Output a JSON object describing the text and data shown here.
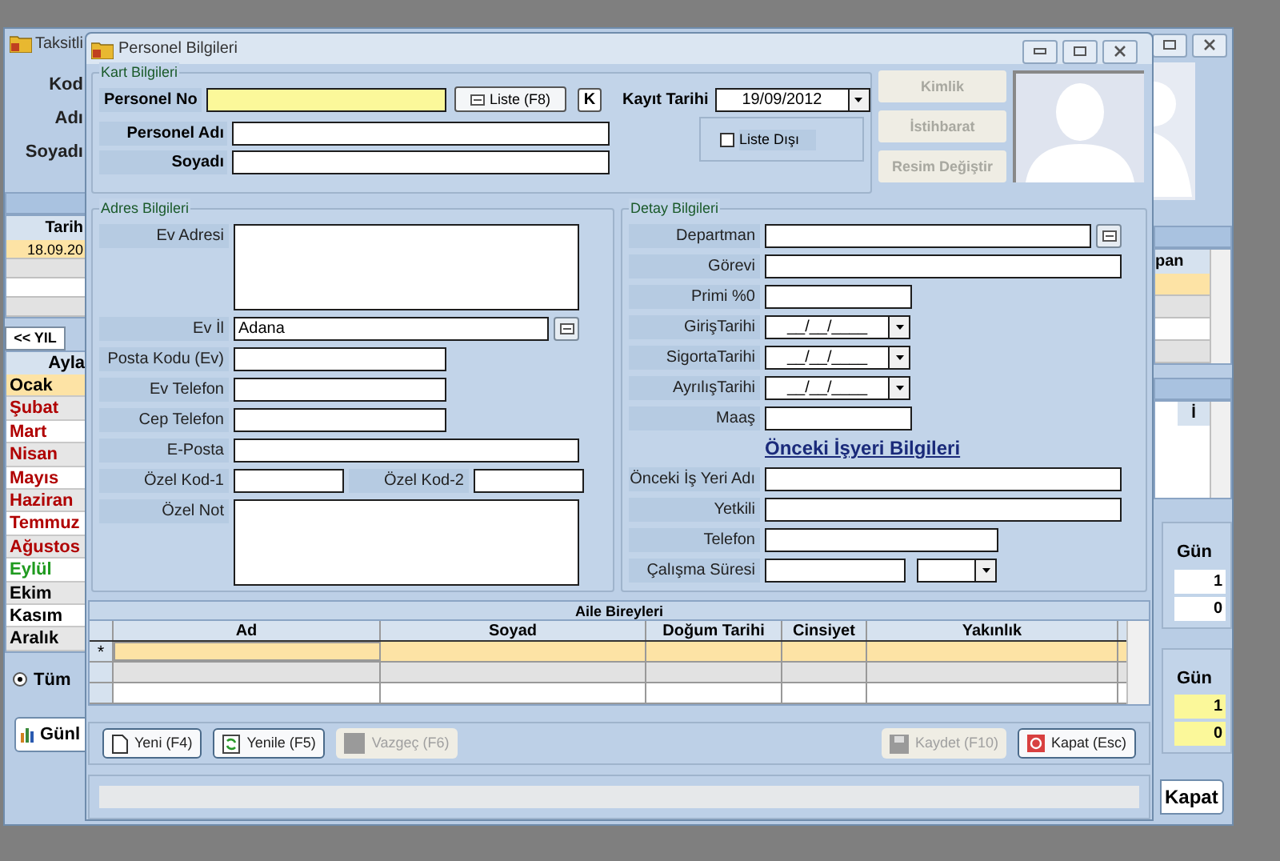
{
  "back_window": {
    "title": "Taksitli",
    "labels": [
      "Kod",
      "Adı",
      "Soyadı"
    ],
    "left_table": {
      "column": "Tarih",
      "rows": [
        {
          "value": "18.09.20",
          "selected": true
        },
        {
          "selected": false
        },
        {
          "selected": false
        },
        {
          "selected": false
        }
      ]
    },
    "year_button": "<< YIL",
    "months_column": "Ayla",
    "months": [
      {
        "name": "Ocak",
        "color": "#000000",
        "selected": true
      },
      {
        "name": "Şubat",
        "color": "#b00000",
        "selected": false
      },
      {
        "name": "Mart",
        "color": "#b00000",
        "selected": false
      },
      {
        "name": "Nisan",
        "color": "#b00000",
        "selected": false
      },
      {
        "name": "Mayıs",
        "color": "#b00000",
        "selected": false
      },
      {
        "name": "Haziran",
        "color": "#b00000",
        "selected": false
      },
      {
        "name": "Temmuz",
        "color": "#b00000",
        "selected": false
      },
      {
        "name": "Ağustos",
        "color": "#b00000",
        "selected": false
      },
      {
        "name": "Eylül",
        "color": "#1f9a1f",
        "selected": false
      },
      {
        "name": "Ekim",
        "color": "#000000",
        "selected": false
      },
      {
        "name": "Kasım",
        "color": "#000000",
        "selected": false
      },
      {
        "name": "Aralık",
        "color": "#000000",
        "selected": false
      }
    ],
    "radio": {
      "label": "Tüm",
      "selected": true
    },
    "report_button": "Günl",
    "right_table_1": {
      "column": "pan",
      "rows": [
        {
          "selected": true
        },
        {
          "selected": false
        },
        {
          "selected": false
        },
        {
          "selected": false
        }
      ]
    },
    "right_table_2": {
      "column": "İ"
    },
    "day_panels": [
      {
        "column": "Gün",
        "values": [
          "1",
          "0"
        ],
        "highlight": false
      },
      {
        "column": "Gün",
        "values": [
          "1",
          "0"
        ],
        "highlight": true
      }
    ],
    "close_button": "Kapat"
  },
  "window": {
    "title": "Personel Bilgileri"
  },
  "kart": {
    "title": "Kart Bilgileri",
    "personel_no": "Personel No",
    "list_button": "Liste (F8)",
    "k_button": "K",
    "date_label": "Kayıt Tarihi",
    "date_value": "19/09/2012",
    "name_label": "Personel Adı",
    "surname_label": "Soyadı",
    "off_list": {
      "label": "Liste Dışı",
      "checked": false
    },
    "side_buttons": [
      {
        "label": "Kimlik",
        "disabled": true
      },
      {
        "label": "İstihbarat",
        "disabled": true
      },
      {
        "label": "Resim Değiştir",
        "disabled": true
      }
    ]
  },
  "adres": {
    "title": "Adres Bilgileri",
    "fields": [
      {
        "kind": "area",
        "label": "Ev Adresi"
      },
      {
        "kind": "lookup",
        "label": "Ev İl",
        "value": "Adana"
      },
      {
        "kind": "short",
        "label": "Posta Kodu (Ev)"
      },
      {
        "kind": "short",
        "label": "Ev Telefon"
      },
      {
        "kind": "short",
        "label": "Cep Telefon"
      },
      {
        "kind": "long",
        "label": "E-Posta"
      },
      {
        "kind": "pair",
        "label": "Özel Kod-1",
        "label_2": "Özel Kod-2"
      },
      {
        "kind": "area",
        "label": "Özel Not"
      }
    ]
  },
  "detay": {
    "title": "Detay Bilgileri",
    "fields": [
      {
        "kind": "lookup",
        "label": "Departman"
      },
      {
        "kind": "long",
        "label": "Görevi"
      },
      {
        "kind": "short",
        "label": "Primi %0"
      },
      {
        "kind": "date",
        "label": "GirişTarihi",
        "value": "__/__/____"
      },
      {
        "kind": "date",
        "label": "SigortaTarihi",
        "value": "__/__/____"
      },
      {
        "kind": "date",
        "label": "AyrılışTarihi",
        "value": "__/__/____"
      },
      {
        "kind": "short",
        "label": "Maaş"
      },
      {
        "kind": "heading",
        "label": "Önceki İşyeri Bilgileri"
      },
      {
        "kind": "long",
        "label": "Önceki  İş Yeri Adı"
      },
      {
        "kind": "long",
        "label": "Yetkili"
      },
      {
        "kind": "medium",
        "label": "Telefon"
      },
      {
        "kind": "combo",
        "label": "Çalışma Süresi"
      }
    ]
  },
  "family": {
    "title": "Aile Bireyleri",
    "columns": [
      "Ad",
      "Soyad",
      "Doğum Tarihi",
      "Cinsiyet",
      "Yakınlık"
    ],
    "rows": [
      {
        "marker": "*",
        "selected": true
      },
      {
        "selected": false
      },
      {
        "selected": false
      }
    ]
  },
  "buttons": [
    {
      "kind": "new",
      "label": "Yeni (F4)",
      "disabled": false
    },
    {
      "kind": "refresh",
      "label": "Yenile (F5)",
      "disabled": false
    },
    {
      "kind": "cancel",
      "label": "Vazgeç (F6)",
      "disabled": true
    },
    {
      "kind": "spacer"
    },
    {
      "kind": "save",
      "label": "Kaydet (F10)",
      "disabled": true
    },
    {
      "kind": "close",
      "label": "Kapat (Esc)",
      "disabled": false
    }
  ]
}
